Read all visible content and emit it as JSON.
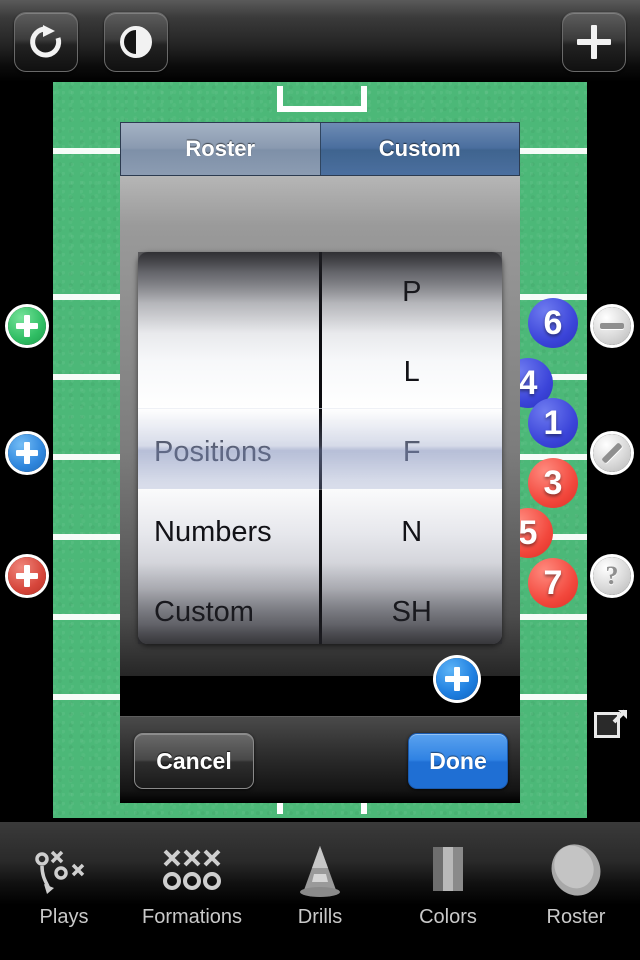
{
  "toolbar": {
    "refresh_label": "refresh-icon",
    "contrast_label": "contrast-icon",
    "add_label": "add-icon"
  },
  "field": {
    "color": "#4cb878",
    "line_color": "#ffffff",
    "tokens": [
      {
        "number": "6",
        "team": "blue"
      },
      {
        "number": "4",
        "team": "blue"
      },
      {
        "number": "1",
        "team": "blue"
      },
      {
        "number": "3",
        "team": "red"
      },
      {
        "number": "5",
        "team": "red"
      },
      {
        "number": "7",
        "team": "red"
      }
    ]
  },
  "side_buttons": {
    "left": [
      {
        "name": "add-green-player",
        "glyph": "+",
        "color": "#2fbd63"
      },
      {
        "name": "add-blue-player",
        "glyph": "+",
        "color": "#2f86dd"
      },
      {
        "name": "add-red-player",
        "glyph": "+",
        "color": "#d6463b"
      }
    ],
    "right": [
      {
        "name": "remove-player",
        "glyph": "−",
        "color": "#d9d9d9"
      },
      {
        "name": "draw-line",
        "glyph": "/",
        "color": "#d9d9d9"
      },
      {
        "name": "help",
        "glyph": "?",
        "color": "#d9d9d9"
      }
    ]
  },
  "modal": {
    "tabs": [
      {
        "label": "Roster",
        "selected": false
      },
      {
        "label": "Custom",
        "selected": true
      }
    ],
    "picker": {
      "left_wheel": {
        "items": [
          "",
          "",
          "Positions",
          "Numbers",
          "Custom"
        ],
        "selected": "Positions",
        "selected_index": 2
      },
      "right_wheel": {
        "items": [
          "P",
          "L",
          "F",
          "N",
          "SH"
        ],
        "selected": "F",
        "selected_index": 2
      }
    },
    "add_button": "add-custom-icon",
    "cancel_label": "Cancel",
    "done_label": "Done",
    "done_color": "#1f6fd4"
  },
  "tabbar": {
    "items": [
      {
        "label": "Plays",
        "icon": "plays-icon"
      },
      {
        "label": "Formations",
        "icon": "formations-icon"
      },
      {
        "label": "Drills",
        "icon": "cone-icon"
      },
      {
        "label": "Colors",
        "icon": "colors-icon"
      },
      {
        "label": "Roster",
        "icon": "ball-icon"
      }
    ]
  }
}
